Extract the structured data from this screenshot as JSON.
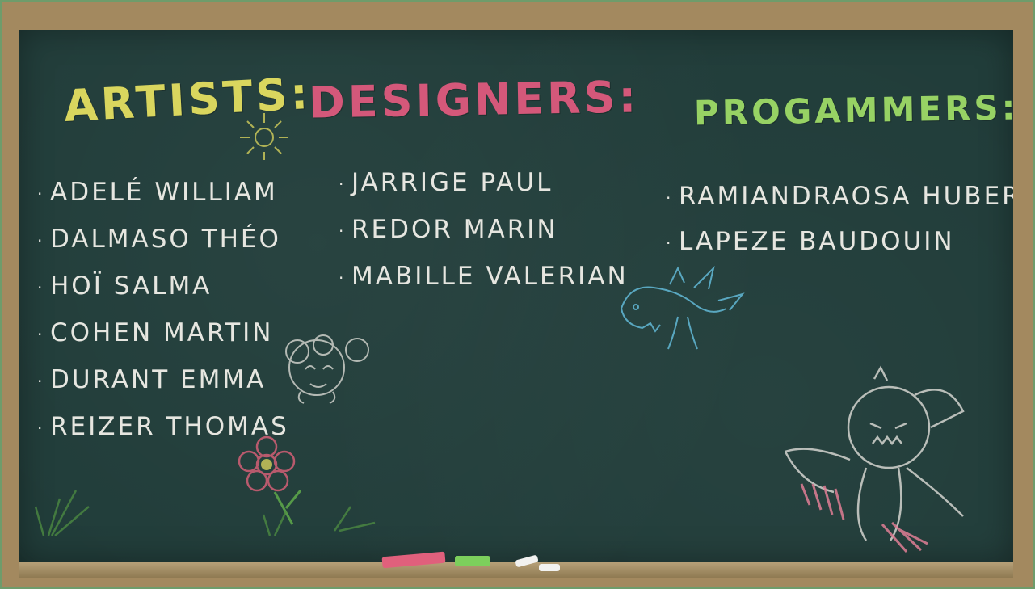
{
  "board": {
    "chalk_colors": {
      "artists": "#d9d65e",
      "designers": "#d4587a",
      "programmers": "#97d264",
      "names": "#e6e6e0",
      "board": "#203c39",
      "frame": "#a3895f"
    }
  },
  "columns": {
    "artists": {
      "heading": "ARTISTS:",
      "names": [
        "ADELÉ WILLIAM",
        "DALMASO THÉO",
        "HOÏ SALMA",
        "COHEN MARTIN",
        "DURANT EMMA",
        "REIZER THOMAS"
      ]
    },
    "designers": {
      "heading": "DESIGNERS:",
      "names": [
        "JARRIGE PAUL",
        "REDOR MARIN",
        "MABILLE VALERIAN"
      ]
    },
    "programmers": {
      "heading": "PROGAMMERS:",
      "names": [
        "RAMIANDRAOSA HUBERT",
        "LAPEZE BAUDOUIN"
      ]
    }
  },
  "doodles": [
    "sun-doodle-icon",
    "flower-doodle-icon",
    "grass-doodle-icon",
    "round-creature-doodle-icon",
    "dragon-doodle-icon",
    "owl-doodle-icon"
  ],
  "chalk_sticks": [
    "#e0607c",
    "#7ccf5c",
    "#f2f2f0"
  ]
}
